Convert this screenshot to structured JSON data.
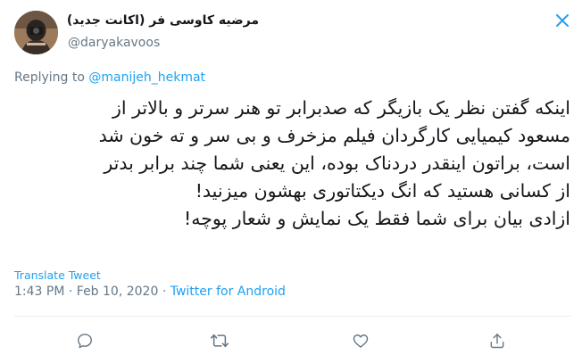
{
  "author": {
    "display_name": "مرضیه کاوسی فر (اکانت جدید)",
    "handle": "@daryakavoos"
  },
  "reply": {
    "prefix": "Replying to ",
    "mention": "@manijeh_hekmat"
  },
  "tweet": {
    "lines": [
      "اینکه گفتن نظر یک بازیگر که صدبرابر تو هنر  سرتر و بالاتر از",
      "مسعود کیمیایی کارگردان فیلم مزخرف و بی سر و ته خون شد",
      "است، براتون اینقدر دردناک بوده، این یعنی شما چند برابر بدتر",
      "از کسانی هستید که انگ دیکتاتوری بهشون میزنید!",
      "ازادی بیان برای شما فقط یک نمایش و شعار پوچه!"
    ]
  },
  "translate_label": "Translate Tweet",
  "meta": {
    "time": "1:43 PM",
    "separator1": " · ",
    "date": "Feb 10, 2020",
    "separator2": " · ",
    "source": "Twitter for Android"
  },
  "icons": {
    "close": "close-icon",
    "reply": "reply-icon",
    "retweet": "retweet-icon",
    "like": "heart-icon",
    "share": "share-icon"
  },
  "colors": {
    "accent": "#1da1f2",
    "text": "#14171a",
    "secondary": "#657786",
    "divider": "#e6ecf0"
  }
}
